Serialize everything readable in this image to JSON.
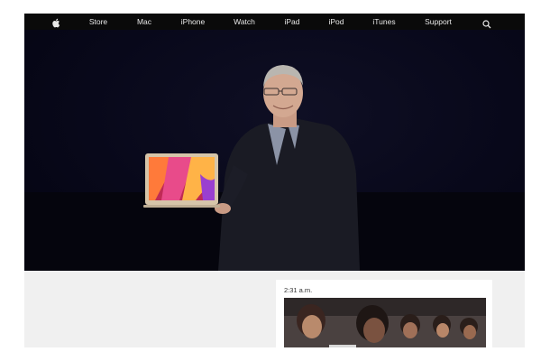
{
  "nav": {
    "items": [
      {
        "label": "Store",
        "name": "nav-store"
      },
      {
        "label": "Mac",
        "name": "nav-mac"
      },
      {
        "label": "iPhone",
        "name": "nav-iphone"
      },
      {
        "label": "Watch",
        "name": "nav-watch"
      },
      {
        "label": "iPad",
        "name": "nav-ipad"
      },
      {
        "label": "iPod",
        "name": "nav-ipod"
      },
      {
        "label": "iTunes",
        "name": "nav-itunes"
      },
      {
        "label": "Support",
        "name": "nav-support"
      }
    ],
    "logo_icon": "apple-logo-icon",
    "search_icon": "search-icon"
  },
  "feed": {
    "timestamp": "2:31 a.m."
  },
  "colors": {
    "nav_bg": "#0a0a0a",
    "nav_text": "#e8e8e8",
    "hero_bg": "#08081a",
    "page_bg": "#f0f0f0"
  }
}
